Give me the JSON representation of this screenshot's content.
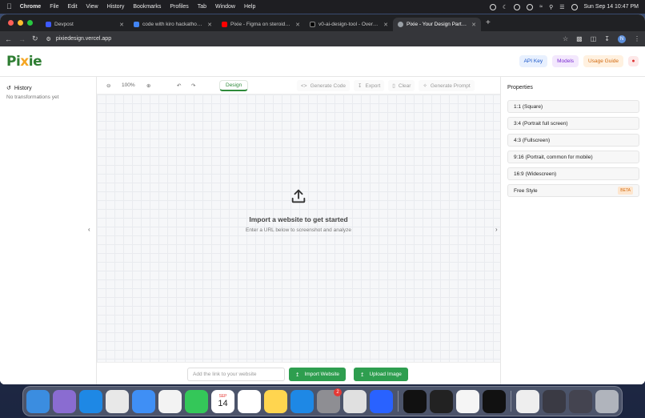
{
  "menubar": {
    "items": [
      "Chrome",
      "File",
      "Edit",
      "View",
      "History",
      "Bookmarks",
      "Profiles",
      "Tab",
      "Window",
      "Help"
    ],
    "clock": "Sun Sep 14  10:47 PM"
  },
  "browser": {
    "tabs": [
      {
        "title": "Devpost",
        "color": "#3d5afe",
        "active": false
      },
      {
        "title": "code with kiro hackathon quo",
        "color": "#4285f4",
        "active": false
      },
      {
        "title": "Pixie - Figma on steroids - Yo",
        "color": "#ff0000",
        "active": false
      },
      {
        "title": "v0-ai-design-tool - Overview",
        "color": "#000000",
        "active": false
      },
      {
        "title": "Pixie - Your Design Partner",
        "color": "#9aa0a6",
        "active": true
      }
    ],
    "url": "pixiedesign.vercel.app",
    "profile_initial": "N"
  },
  "app": {
    "logo": {
      "pre": "Pi",
      "x": "x",
      "post": "ie"
    },
    "header_buttons": {
      "api": "API Key",
      "models": "Models",
      "guide": "Usage Guide"
    },
    "history": {
      "title": "History",
      "empty": "No transformations yet"
    },
    "toolbar": {
      "zoom": "100%",
      "design": "Design",
      "generate_code": "Generate Code",
      "export": "Export",
      "clear": "Clear",
      "generate_prompt": "Generate Prompt"
    },
    "canvas": {
      "title": "Import a website to get started",
      "subtitle": "Enter a URL below to screenshot and analyze"
    },
    "bottom": {
      "placeholder": "Add the link to your website",
      "import": "Import Website",
      "upload": "Upload Image"
    },
    "properties": {
      "title": "Properties",
      "options": [
        "1:1 (Square)",
        "3:4 (Portrait full screen)",
        "4:3 (Fullscreen)",
        "9:16 (Portrait, common for mobile)",
        "16:9 (Widescreen)",
        "Free Style"
      ],
      "beta": "BETA"
    }
  },
  "dock": {
    "apps": [
      {
        "name": "finder-icon",
        "color": "#3b8de0"
      },
      {
        "name": "launchpad-icon",
        "color": "#8a6cd1"
      },
      {
        "name": "safari-icon",
        "color": "#1e88e5"
      },
      {
        "name": "chrome-icon",
        "color": "#e8e8e8"
      },
      {
        "name": "mail-icon",
        "color": "#3f8ff5"
      },
      {
        "name": "photos-icon",
        "color": "#f3f3f3"
      },
      {
        "name": "facetime-icon",
        "color": "#34c759"
      },
      {
        "name": "calendar-icon",
        "color": "#ffffff"
      },
      {
        "name": "reminders-icon",
        "color": "#ffffff"
      },
      {
        "name": "notes-icon",
        "color": "#ffd54f"
      },
      {
        "name": "appstore-icon",
        "color": "#1e88e5"
      },
      {
        "name": "settings-icon",
        "color": "#8e8e93"
      },
      {
        "name": "notion-icon",
        "color": "#e0e0e0"
      },
      {
        "name": "tasks-icon",
        "color": "#2962ff"
      },
      {
        "name": "terminal-icon",
        "color": "#111111"
      },
      {
        "name": "unity-icon",
        "color": "#222222"
      },
      {
        "name": "clock-icon",
        "color": "#f5f5f5"
      },
      {
        "name": "capcut-icon",
        "color": "#111111"
      },
      {
        "name": "music-icon",
        "color": "#eeeeee"
      },
      {
        "name": "window-thumb-icon",
        "color": "#3a3a44"
      },
      {
        "name": "window-thumb-icon",
        "color": "#444450"
      },
      {
        "name": "trash-icon",
        "color": "#b0b4bc"
      }
    ],
    "calendar_month": "SEP",
    "calendar_day": "14",
    "settings_badge": "2"
  }
}
